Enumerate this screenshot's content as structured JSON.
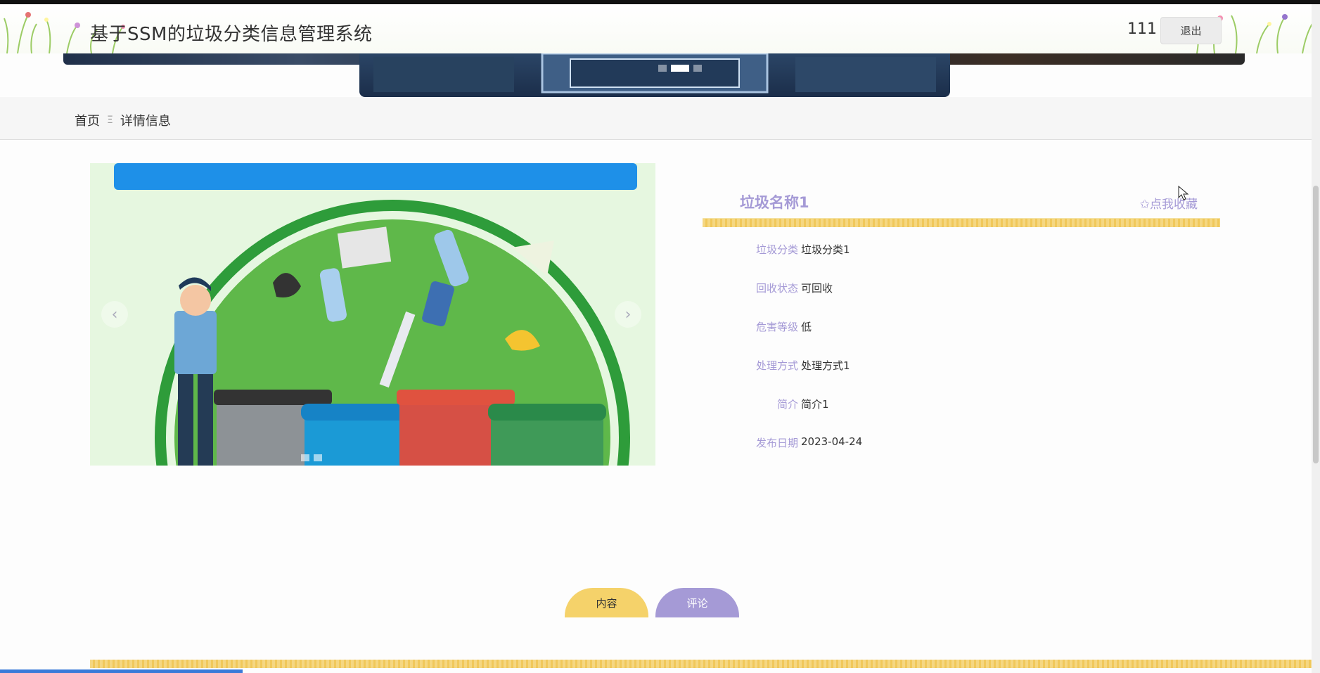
{
  "header": {
    "title": "基于SSM的垃圾分类信息管理系统",
    "username": "111",
    "logout_label": "退出"
  },
  "breadcrumb": {
    "home": "首页",
    "separator": "Ξ",
    "current": "详情信息"
  },
  "detail": {
    "name": "垃圾名称1",
    "favorite_label": "✩点我收藏",
    "fields": [
      {
        "label": "垃圾分类",
        "value": "垃圾分类1"
      },
      {
        "label": "回收状态",
        "value": "可回收"
      },
      {
        "label": "危害等级",
        "value": "低"
      },
      {
        "label": "处理方式",
        "value": "处理方式1"
      },
      {
        "label": "简介",
        "value": "简介1"
      },
      {
        "label": "发布日期",
        "value": "2023-04-24"
      }
    ]
  },
  "tabs": {
    "content": "内容",
    "comment": "评论"
  },
  "colors": {
    "accent_purple": "#a59ad6",
    "accent_yellow": "#f5d26a"
  }
}
